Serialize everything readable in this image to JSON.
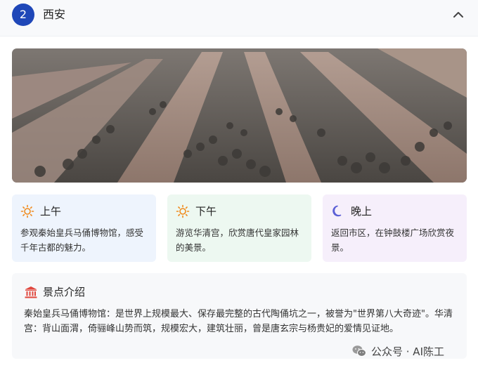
{
  "header": {
    "day_number": "2",
    "city": "西安",
    "collapse_icon": "chevron-up-icon"
  },
  "photo": {
    "alt": "Terracotta warriors in excavation pits"
  },
  "schedule": [
    {
      "period": "上午",
      "icon": "sun-icon",
      "text": "参观秦始皇兵马俑博物馆，感受千年古都的魅力。",
      "color": "#eef4fd"
    },
    {
      "period": "下午",
      "icon": "sun-icon",
      "text": "游览华清宫，欣赏唐代皇家园林的美景。",
      "color": "#edf8f1"
    },
    {
      "period": "晚上",
      "icon": "moon-icon",
      "text": "返回市区，在钟鼓楼广场欣赏夜景。",
      "color": "#f6effb"
    }
  ],
  "intro": {
    "icon": "landmark-icon",
    "title": "景点介绍",
    "text": "秦始皇兵马俑博物馆：是世界上规模最大、保存最完整的古代陶俑坑之一，被誉为\"世界第八大奇迹\"。华清宫：背山面渭，倚骊峰山势而筑，规模宏大，建筑壮丽，曾是唐玄宗与杨贵妃的爱情见证地。"
  },
  "watermark": {
    "icon": "wechat-icon",
    "text": "公众号 · AI陈工"
  },
  "colors": {
    "accent": "#1f47b8",
    "sun": "#f08a1c",
    "moon": "#5b5fd6",
    "landmark": "#e0463c"
  }
}
